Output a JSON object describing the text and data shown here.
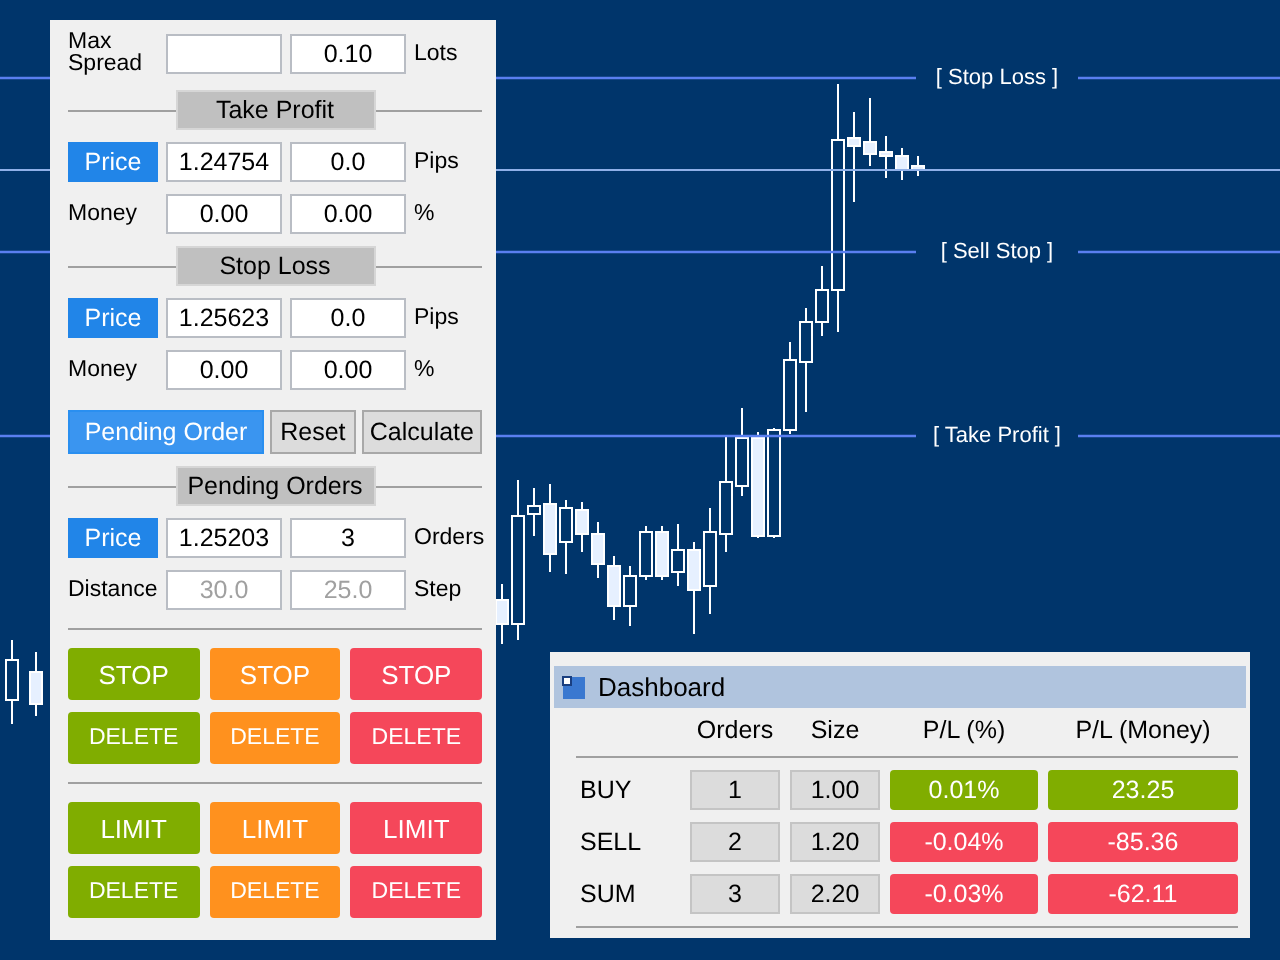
{
  "chart": {
    "lines": [
      {
        "kind": "labeled",
        "label": "[ Stop Loss ]"
      },
      {
        "kind": "price"
      },
      {
        "kind": "labeled",
        "label": "[ Sell Stop ]"
      },
      {
        "kind": "labeled",
        "label": "[ Take Profit ]"
      }
    ]
  },
  "panel": {
    "max_spread": {
      "label": "Max Spread",
      "lots": "0.10",
      "lots_unit": "Lots"
    },
    "take_profit": {
      "title": "Take Profit",
      "price_button": "Price",
      "price": "1.24754",
      "pips": "0.0",
      "pips_unit": "Pips",
      "money_label": "Money",
      "money": "0.00",
      "percent": "0.00",
      "percent_unit": "%"
    },
    "stop_loss": {
      "title": "Stop Loss",
      "price_button": "Price",
      "price": "1.25623",
      "pips": "0.0",
      "pips_unit": "Pips",
      "money_label": "Money",
      "money": "0.00",
      "percent": "0.00",
      "percent_unit": "%"
    },
    "actions": [
      {
        "label": "Pending Order",
        "kind": "primary"
      },
      {
        "label": "Reset",
        "kind": "secondary"
      },
      {
        "label": "Calculate",
        "kind": "secondary"
      }
    ],
    "pending": {
      "title": "Pending Orders",
      "price_button": "Price",
      "price": "1.25203",
      "orders": "3",
      "orders_unit": "Orders",
      "distance_label": "Distance",
      "distance": {
        "value": "30.0",
        "disabled": true
      },
      "step": {
        "value": "25.0",
        "disabled": true
      },
      "step_unit": "Step"
    },
    "order_groups": [
      {
        "rows": [
          [
            {
              "label": "STOP",
              "color": "#80ad00"
            },
            {
              "label": "STOP",
              "color": "#ff911e"
            },
            {
              "label": "STOP",
              "color": "#f5475a"
            }
          ],
          [
            {
              "label": "DELETE",
              "color": "#80ad00"
            },
            {
              "label": "DELETE",
              "color": "#ff911e"
            },
            {
              "label": "DELETE",
              "color": "#f5475a"
            }
          ]
        ]
      },
      {
        "rows": [
          [
            {
              "label": "LIMIT",
              "color": "#80ad00"
            },
            {
              "label": "LIMIT",
              "color": "#ff911e"
            },
            {
              "label": "LIMIT",
              "color": "#f5475a"
            }
          ],
          [
            {
              "label": "DELETE",
              "color": "#80ad00"
            },
            {
              "label": "DELETE",
              "color": "#ff911e"
            },
            {
              "label": "DELETE",
              "color": "#f5475a"
            }
          ]
        ]
      }
    ]
  },
  "dashboard": {
    "title": "Dashboard",
    "columns": [
      "Orders",
      "Size",
      "P/L (%)",
      "P/L (Money)"
    ],
    "rows": [
      {
        "label": "BUY",
        "orders": "1",
        "size": "1.00",
        "pl_percent": {
          "text": "0.01%",
          "color": "#80ad00"
        },
        "pl_money": {
          "text": "23.25",
          "color": "#80ad00"
        }
      },
      {
        "label": "SELL",
        "orders": "2",
        "size": "1.20",
        "pl_percent": {
          "text": "-0.04%",
          "color": "#f5475a"
        },
        "pl_money": {
          "text": "-85.36",
          "color": "#f5475a"
        }
      },
      {
        "label": "SUM",
        "orders": "3",
        "size": "2.20",
        "pl_percent": {
          "text": "-0.03%",
          "color": "#f5475a"
        },
        "pl_money": {
          "text": "-62.11",
          "color": "#f5475a"
        }
      }
    ]
  }
}
